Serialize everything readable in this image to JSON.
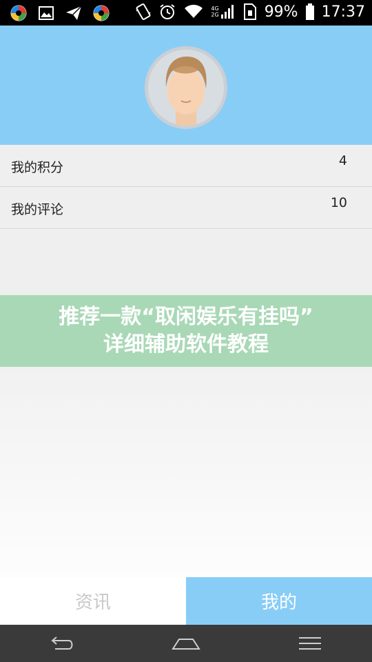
{
  "status_bar": {
    "battery_percent": "99%",
    "time": "17:37",
    "left_icons": [
      "app-icon-1",
      "image-icon",
      "send-icon",
      "app-icon-2"
    ],
    "right_icons": [
      "vibrate-icon",
      "alarm-icon",
      "wifi-icon",
      "signal-icon",
      "battery-icon"
    ],
    "network_labels": [
      "4G",
      "2G"
    ]
  },
  "profile": {
    "avatar_icon": "avatar-face-icon"
  },
  "list": {
    "items": [
      {
        "label": "我的积分",
        "value": "4"
      },
      {
        "label": "我的评论",
        "value": "10"
      }
    ]
  },
  "banner": {
    "line1": "推荐一款“取闲娱乐有挂吗”",
    "line2": "详细辅助软件教程"
  },
  "tabs": {
    "news_label": "资讯",
    "mine_label": "我的"
  },
  "nav": {
    "icons": [
      "back-icon",
      "home-icon",
      "menu-icon"
    ]
  },
  "colors": {
    "header_bg": "#88cdf6",
    "banner_bg": "#a9d8b6",
    "tab_active_bg": "#88cdf6",
    "navbar_bg": "#3a3a3a"
  }
}
